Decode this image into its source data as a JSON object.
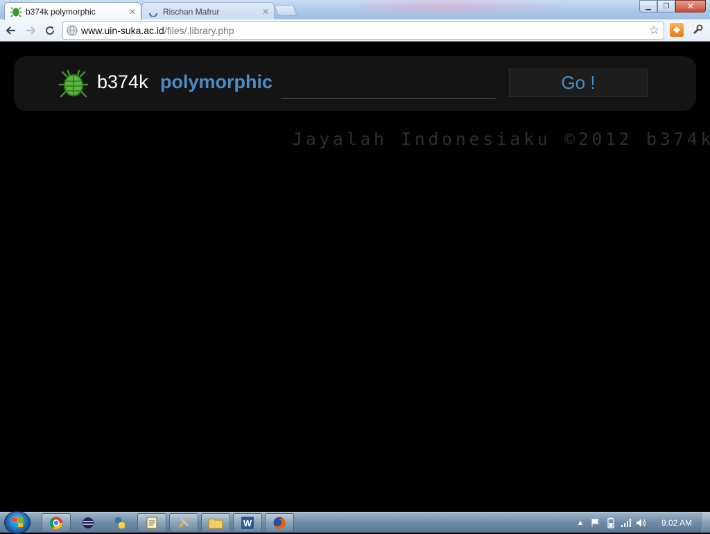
{
  "browser": {
    "tabs": [
      {
        "title": "b374k polymorphic",
        "active": true
      },
      {
        "title": "Rischan Mafrur",
        "active": false
      }
    ],
    "url_host": "www.uin-suka.ac.id",
    "url_path": "/files/.library.php",
    "icons": {
      "back": "back-arrow-icon",
      "forward": "forward-arrow-icon",
      "reload": "reload-icon",
      "bookmark": "star-icon",
      "menu": "wrench-icon"
    }
  },
  "page": {
    "brand_primary": "b374k",
    "brand_secondary": "polymorphic",
    "search_value": "",
    "go_label": "Go !",
    "footer": "Jayalah Indonesiaku ©2012 b374k",
    "colors": {
      "accent": "#4b8cc4",
      "panel": "#141414",
      "background": "#000000"
    }
  },
  "taskbar": {
    "clock": "9:02 AM",
    "apps": [
      "chrome",
      "eclipse",
      "python",
      "notepad",
      "tools",
      "explorer",
      "word",
      "firefox"
    ],
    "word_label": "W"
  }
}
